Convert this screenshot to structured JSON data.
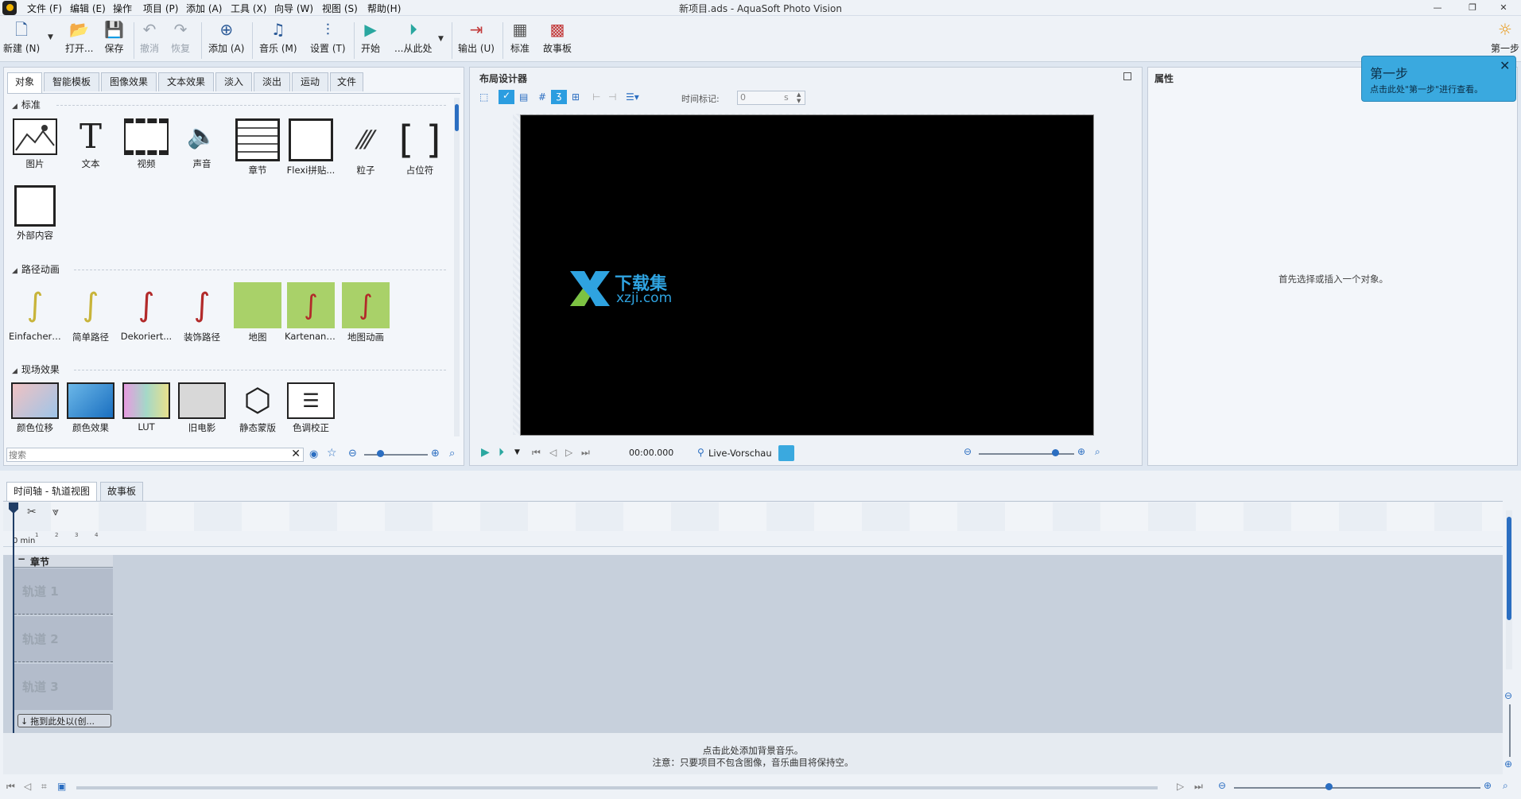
{
  "window": {
    "title": "新项目.ads - AquaSoft Photo Vision",
    "minimize": "—",
    "restore": "❐",
    "close": "✕"
  },
  "menu": [
    {
      "label": "文件 (F)"
    },
    {
      "label": "编辑 (E)"
    },
    {
      "label": "操作"
    },
    {
      "label": "项目 (P)"
    },
    {
      "label": "添加 (A)"
    },
    {
      "label": "工具 (X)"
    },
    {
      "label": "向导 (W)"
    },
    {
      "label": "视图 (S)"
    },
    {
      "label": "帮助(H)"
    }
  ],
  "toolbar": {
    "new": "新建 (N)",
    "open": "打开...",
    "save": "保存",
    "undo": "撤消",
    "redo": "恢复",
    "add": "添加 (A)",
    "music": "音乐 (M)",
    "settings": "设置 (T)",
    "start": "开始",
    "from_here": "...从此处",
    "output": "输出 (U)",
    "standard": "标准",
    "storyboard": "故事板",
    "first_step": "第一步"
  },
  "object_panel": {
    "tabs": [
      "对象",
      "智能模板",
      "图像效果",
      "文本效果",
      "淡入",
      "淡出",
      "运动",
      "文件"
    ],
    "sections": {
      "standard": "标准",
      "path_animation": "路径动画",
      "live_effects": "现场效果"
    },
    "standard_items": [
      "图片",
      "文本",
      "视频",
      "声音",
      "章节",
      "Flexi拼贴...",
      "粒子",
      "占位符",
      "外部内容"
    ],
    "path_items": [
      "Einfacher ...",
      "简单路径",
      "Dekoriert...",
      "装饰路径",
      "地图",
      "Kartenani...",
      "地图动画"
    ],
    "effect_items": [
      "颜色位移",
      "颜色效果",
      "LUT",
      "旧电影",
      "静态蒙版",
      "色调校正"
    ],
    "search_placeholder": "搜索"
  },
  "layout_designer": {
    "title": "布局设计器",
    "time_marker_label": "时间标记:",
    "time_marker_value": "0",
    "time_marker_unit": "s",
    "time_display": "00:00.000",
    "live_preview": "Live-Vorschau",
    "watermark": {
      "cn": "下载集",
      "url": "xzji.com"
    }
  },
  "properties": {
    "title": "属性",
    "empty_hint": "首先选择或插入一个对象。"
  },
  "tooltip": {
    "title": "第一步",
    "text": "点击此处\"第一步\"进行查看。"
  },
  "timeline": {
    "tabs": [
      "时间轴 - 轨道视图",
      "故事板"
    ],
    "ruler_label": "0 min",
    "ruler_ticks": [
      "1",
      "2",
      "3",
      "4"
    ],
    "chapter": "章节",
    "tracks": [
      "轨道 1",
      "轨道 2",
      "轨道 3"
    ],
    "drop_hint": "拖到此处以(创...",
    "music_hint": "点击此处添加背景音乐。",
    "music_note": "注意：只要项目不包含图像，音乐曲目将保持空。"
  },
  "colors": {
    "accent": "#2b6ec1",
    "tooltip_bg": "#3aa9df",
    "stage": "#000000",
    "panel_bg": "#f3f6fa"
  }
}
